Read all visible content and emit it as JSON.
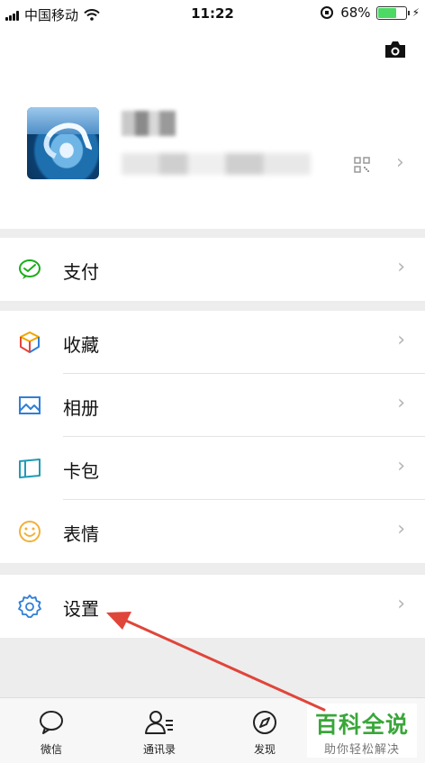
{
  "status_bar": {
    "carrier": "中国移动",
    "time": "11:22",
    "battery": "68%",
    "battery_level": 0.68,
    "icons": [
      "signal-icon",
      "wifi-icon",
      "rotation-lock-icon",
      "battery-icon",
      "charging-icon"
    ]
  },
  "profile": {
    "icons": [
      "camera-icon",
      "qr-code-icon",
      "chevron-right-icon"
    ]
  },
  "menu": {
    "pay": {
      "label": "支付",
      "icon": "wallet-icon",
      "color": "#1aad19"
    },
    "favorites": {
      "label": "收藏",
      "icon": "cube-icon",
      "color": "#f0a500"
    },
    "album": {
      "label": "相册",
      "icon": "image-icon",
      "color": "#2f7fd8"
    },
    "cards": {
      "label": "卡包",
      "icon": "card-icon",
      "color": "#1f9bb5"
    },
    "stickers": {
      "label": "表情",
      "icon": "smiley-icon",
      "color": "#f2b035"
    },
    "settings": {
      "label": "设置",
      "icon": "gear-icon",
      "color": "#2f7fd8"
    }
  },
  "tabbar": {
    "chats": "微信",
    "contacts": "通讯录",
    "discover": "发现"
  },
  "watermark": {
    "title": "百科全说",
    "subtitle": "助你轻松解决"
  },
  "annotation": {
    "arrow_color": "#e0453a",
    "points_to": "settings"
  }
}
